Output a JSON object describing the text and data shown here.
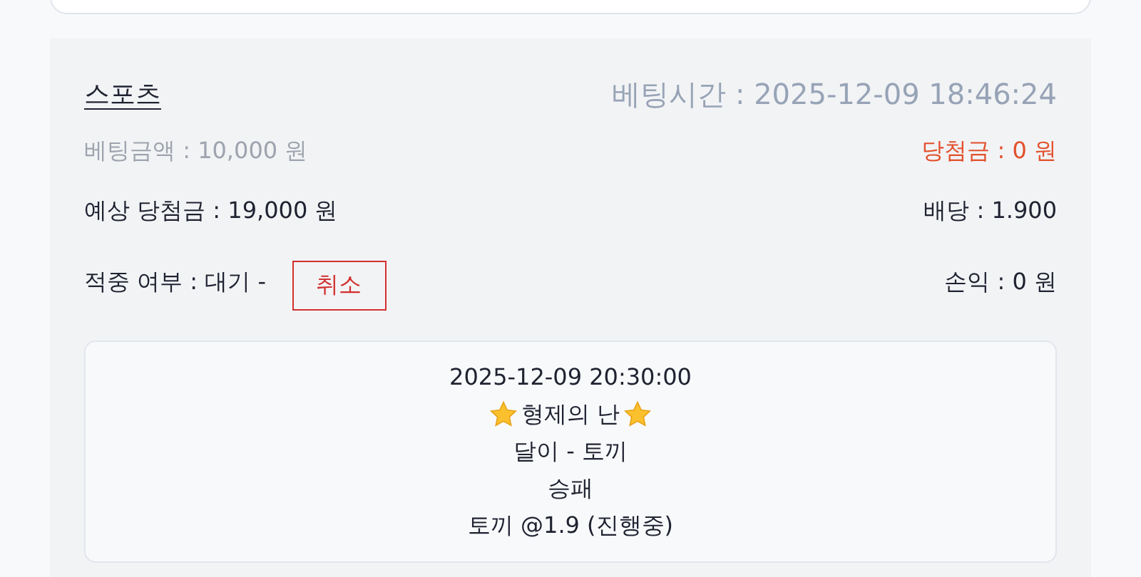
{
  "bet": {
    "category": "스포츠",
    "bet_time": "베팅시간 : 2025-12-09 18:46:24",
    "amount": "베팅금액 : 10,000 원",
    "winnings": "당첨금 : 0 원",
    "expected": "예상 당첨금 : 19,000 원",
    "odds": "배당 : 1.900",
    "result": "적중 여부 : 대기 -",
    "cancel_button": "취소",
    "profit": "손익 : 0 원"
  },
  "selection": {
    "datetime": "2025-12-09 20:30:00",
    "title": "형제의 난",
    "teams": "달이 - 토끼",
    "market": "승패",
    "pick": "토끼 @1.9 (진행중)"
  }
}
